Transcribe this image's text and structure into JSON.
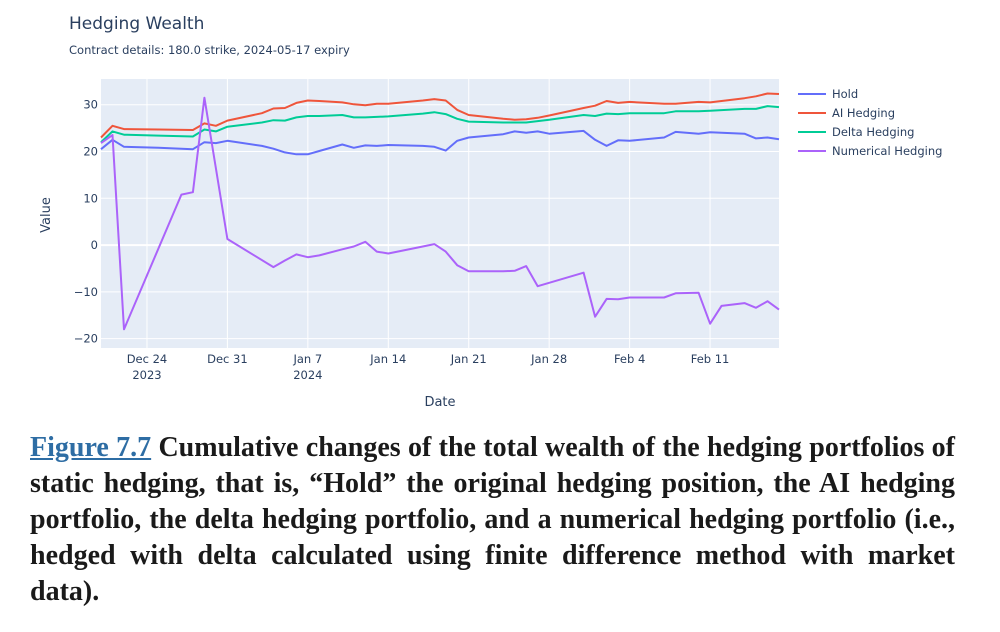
{
  "chart_data": {
    "type": "line",
    "title": "Hedging Wealth",
    "subtitle": "Contract details: 180.0 strike, 2024-05-17 expiry",
    "xlabel": "Date",
    "ylabel": "Value",
    "xlim": [
      "2023-12-20",
      "2024-02-17"
    ],
    "ylim": [
      -22,
      35.5
    ],
    "yticks": [
      -20,
      -10,
      0,
      10,
      20,
      30
    ],
    "xticks": [
      {
        "date": "2023-12-24",
        "label": "Dec 24",
        "label2": "2023"
      },
      {
        "date": "2023-12-31",
        "label": "Dec 31",
        "label2": ""
      },
      {
        "date": "2024-01-07",
        "label": "Jan 7",
        "label2": "2024"
      },
      {
        "date": "2024-01-14",
        "label": "Jan 14",
        "label2": ""
      },
      {
        "date": "2024-01-21",
        "label": "Jan 21",
        "label2": ""
      },
      {
        "date": "2024-01-28",
        "label": "Jan 28",
        "label2": ""
      },
      {
        "date": "2024-02-04",
        "label": "Feb 4",
        "label2": ""
      },
      {
        "date": "2024-02-11",
        "label": "Feb 11",
        "label2": ""
      }
    ],
    "grid": true,
    "legend_position": "right",
    "plot_bgcolor": "#e5ecf6",
    "series": [
      {
        "name": "Hold",
        "color": "#636efa",
        "points": [
          [
            "2023-12-20",
            20.5
          ],
          [
            "2023-12-21",
            22.5
          ],
          [
            "2023-12-22",
            21.0
          ],
          [
            "2023-12-25",
            20.8
          ],
          [
            "2023-12-28",
            20.5
          ],
          [
            "2023-12-29",
            22.0
          ],
          [
            "2023-12-30",
            21.8
          ],
          [
            "2023-12-31",
            22.3
          ],
          [
            "2024-01-03",
            21.2
          ],
          [
            "2024-01-04",
            20.6
          ],
          [
            "2024-01-05",
            19.8
          ],
          [
            "2024-01-06",
            19.4
          ],
          [
            "2024-01-07",
            19.4
          ],
          [
            "2024-01-08",
            20.1
          ],
          [
            "2024-01-10",
            21.5
          ],
          [
            "2024-01-11",
            20.8
          ],
          [
            "2024-01-12",
            21.3
          ],
          [
            "2024-01-13",
            21.2
          ],
          [
            "2024-01-14",
            21.4
          ],
          [
            "2024-01-17",
            21.2
          ],
          [
            "2024-01-18",
            21.0
          ],
          [
            "2024-01-19",
            20.2
          ],
          [
            "2024-01-20",
            22.3
          ],
          [
            "2024-01-21",
            23.0
          ],
          [
            "2024-01-24",
            23.7
          ],
          [
            "2024-01-25",
            24.3
          ],
          [
            "2024-01-26",
            24.0
          ],
          [
            "2024-01-27",
            24.3
          ],
          [
            "2024-01-28",
            23.8
          ],
          [
            "2024-01-31",
            24.4
          ],
          [
            "2024-02-01",
            22.5
          ],
          [
            "2024-02-02",
            21.2
          ],
          [
            "2024-02-03",
            22.4
          ],
          [
            "2024-02-04",
            22.3
          ],
          [
            "2024-02-07",
            23.0
          ],
          [
            "2024-02-08",
            24.2
          ],
          [
            "2024-02-10",
            23.8
          ],
          [
            "2024-02-11",
            24.1
          ],
          [
            "2024-02-14",
            23.8
          ],
          [
            "2024-02-15",
            22.8
          ],
          [
            "2024-02-16",
            23.0
          ],
          [
            "2024-02-17",
            22.6
          ]
        ]
      },
      {
        "name": "AI Hedging",
        "color": "#ef553b",
        "points": [
          [
            "2023-12-20",
            23.0
          ],
          [
            "2023-12-21",
            25.5
          ],
          [
            "2023-12-22",
            24.8
          ],
          [
            "2023-12-25",
            24.7
          ],
          [
            "2023-12-28",
            24.6
          ],
          [
            "2023-12-29",
            26.0
          ],
          [
            "2023-12-30",
            25.5
          ],
          [
            "2023-12-31",
            26.6
          ],
          [
            "2024-01-03",
            28.2
          ],
          [
            "2024-01-04",
            29.2
          ],
          [
            "2024-01-05",
            29.3
          ],
          [
            "2024-01-06",
            30.4
          ],
          [
            "2024-01-07",
            30.9
          ],
          [
            "2024-01-08",
            30.8
          ],
          [
            "2024-01-10",
            30.5
          ],
          [
            "2024-01-11",
            30.1
          ],
          [
            "2024-01-12",
            29.9
          ],
          [
            "2024-01-13",
            30.2
          ],
          [
            "2024-01-14",
            30.2
          ],
          [
            "2024-01-17",
            30.9
          ],
          [
            "2024-01-18",
            31.2
          ],
          [
            "2024-01-19",
            30.9
          ],
          [
            "2024-01-20",
            28.9
          ],
          [
            "2024-01-21",
            27.8
          ],
          [
            "2024-01-24",
            27.0
          ],
          [
            "2024-01-25",
            26.8
          ],
          [
            "2024-01-26",
            26.9
          ],
          [
            "2024-01-27",
            27.2
          ],
          [
            "2024-01-28",
            27.7
          ],
          [
            "2024-01-31",
            29.3
          ],
          [
            "2024-02-01",
            29.8
          ],
          [
            "2024-02-02",
            30.8
          ],
          [
            "2024-02-03",
            30.4
          ],
          [
            "2024-02-04",
            30.6
          ],
          [
            "2024-02-07",
            30.2
          ],
          [
            "2024-02-08",
            30.2
          ],
          [
            "2024-02-10",
            30.6
          ],
          [
            "2024-02-11",
            30.5
          ],
          [
            "2024-02-14",
            31.4
          ],
          [
            "2024-02-15",
            31.8
          ],
          [
            "2024-02-16",
            32.4
          ],
          [
            "2024-02-17",
            32.3
          ]
        ]
      },
      {
        "name": "Delta Hedging",
        "color": "#00cc96",
        "points": [
          [
            "2023-12-20",
            22.0
          ],
          [
            "2023-12-21",
            24.3
          ],
          [
            "2023-12-22",
            23.6
          ],
          [
            "2023-12-25",
            23.4
          ],
          [
            "2023-12-28",
            23.2
          ],
          [
            "2023-12-29",
            24.7
          ],
          [
            "2023-12-30",
            24.3
          ],
          [
            "2023-12-31",
            25.3
          ],
          [
            "2024-01-03",
            26.2
          ],
          [
            "2024-01-04",
            26.7
          ],
          [
            "2024-01-05",
            26.6
          ],
          [
            "2024-01-06",
            27.3
          ],
          [
            "2024-01-07",
            27.6
          ],
          [
            "2024-01-08",
            27.6
          ],
          [
            "2024-01-10",
            27.8
          ],
          [
            "2024-01-11",
            27.3
          ],
          [
            "2024-01-12",
            27.3
          ],
          [
            "2024-01-13",
            27.4
          ],
          [
            "2024-01-14",
            27.5
          ],
          [
            "2024-01-17",
            28.1
          ],
          [
            "2024-01-18",
            28.4
          ],
          [
            "2024-01-19",
            28.0
          ],
          [
            "2024-01-20",
            27.0
          ],
          [
            "2024-01-21",
            26.4
          ],
          [
            "2024-01-24",
            26.2
          ],
          [
            "2024-01-25",
            26.2
          ],
          [
            "2024-01-26",
            26.2
          ],
          [
            "2024-01-27",
            26.5
          ],
          [
            "2024-01-28",
            26.8
          ],
          [
            "2024-01-31",
            27.8
          ],
          [
            "2024-02-01",
            27.6
          ],
          [
            "2024-02-02",
            28.1
          ],
          [
            "2024-02-03",
            28.0
          ],
          [
            "2024-02-04",
            28.2
          ],
          [
            "2024-02-07",
            28.2
          ],
          [
            "2024-02-08",
            28.6
          ],
          [
            "2024-02-10",
            28.6
          ],
          [
            "2024-02-11",
            28.7
          ],
          [
            "2024-02-14",
            29.1
          ],
          [
            "2024-02-15",
            29.1
          ],
          [
            "2024-02-16",
            29.7
          ],
          [
            "2024-02-17",
            29.5
          ]
        ]
      },
      {
        "name": "Numerical Hedging",
        "color": "#ab63fa",
        "points": [
          [
            "2023-12-20",
            21.8
          ],
          [
            "2023-12-21",
            23.5
          ],
          [
            "2023-12-22",
            -18.0
          ],
          [
            "2023-12-27",
            10.8
          ],
          [
            "2023-12-28",
            11.3
          ],
          [
            "2023-12-29",
            31.5
          ],
          [
            "2023-12-31",
            1.3
          ],
          [
            "2024-01-04",
            -4.7
          ],
          [
            "2024-01-05",
            -3.3
          ],
          [
            "2024-01-06",
            -2.0
          ],
          [
            "2024-01-07",
            -2.6
          ],
          [
            "2024-01-08",
            -2.2
          ],
          [
            "2024-01-10",
            -0.9
          ],
          [
            "2024-01-11",
            -0.3
          ],
          [
            "2024-01-12",
            0.7
          ],
          [
            "2024-01-13",
            -1.4
          ],
          [
            "2024-01-14",
            -1.8
          ],
          [
            "2024-01-17",
            -0.3
          ],
          [
            "2024-01-18",
            0.2
          ],
          [
            "2024-01-19",
            -1.4
          ],
          [
            "2024-01-20",
            -4.3
          ],
          [
            "2024-01-21",
            -5.6
          ],
          [
            "2024-01-24",
            -5.6
          ],
          [
            "2024-01-25",
            -5.5
          ],
          [
            "2024-01-26",
            -4.5
          ],
          [
            "2024-01-27",
            -8.8
          ],
          [
            "2024-01-31",
            -5.9
          ],
          [
            "2024-02-01",
            -15.3
          ],
          [
            "2024-02-02",
            -11.5
          ],
          [
            "2024-02-03",
            -11.6
          ],
          [
            "2024-02-04",
            -11.2
          ],
          [
            "2024-02-07",
            -11.2
          ],
          [
            "2024-02-08",
            -10.3
          ],
          [
            "2024-02-10",
            -10.2
          ],
          [
            "2024-02-11",
            -16.8
          ],
          [
            "2024-02-12",
            -13.0
          ],
          [
            "2024-02-14",
            -12.4
          ],
          [
            "2024-02-15",
            -13.4
          ],
          [
            "2024-02-16",
            -12.0
          ],
          [
            "2024-02-17",
            -13.8
          ]
        ]
      }
    ]
  },
  "caption": {
    "label": "Figure 7.7",
    "text": " Cumulative changes of the total wealth of the hedging portfolios of static hedging, that is, “Hold” the original hedging position, the AI hedging portfolio, the delta hedging portfolio, and a numerical hedging portfolio (i.e., hedged with delta calculated using finite difference method with market data)."
  }
}
